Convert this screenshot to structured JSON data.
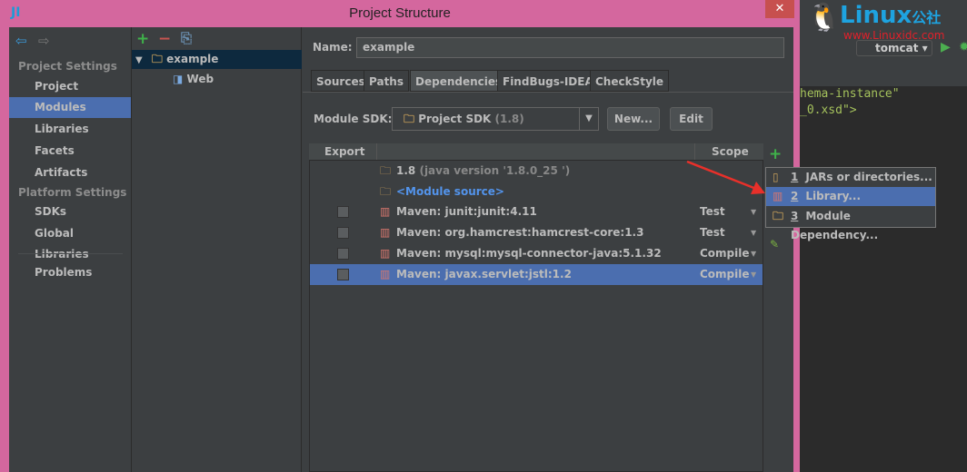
{
  "window": {
    "title": "Project Structure",
    "close": "✕",
    "logo": "JI"
  },
  "nav": {
    "back": "⇦",
    "forward": "⇨"
  },
  "sidebar": {
    "project_settings": "Project Settings",
    "items": [
      "Project",
      "Modules",
      "Libraries",
      "Facets",
      "Artifacts"
    ],
    "platform_settings": "Platform Settings",
    "platform_items": [
      "SDKs",
      "Global Libraries"
    ],
    "problems": "Problems"
  },
  "tree": {
    "add": "+",
    "remove": "−",
    "copy": "⎘",
    "module": "example",
    "facet": "Web"
  },
  "form": {
    "name_label": "Name:",
    "name_value": "example",
    "sdk_label": "Module SDK:",
    "sdk_value": "Project SDK",
    "sdk_version": "(1.8)",
    "new_btn": "New...",
    "edit_btn": "Edit"
  },
  "tabs": [
    "Sources",
    "Paths",
    "Dependencies",
    "FindBugs-IDEA",
    "CheckStyle"
  ],
  "table": {
    "headers": {
      "export": "Export",
      "scope": "Scope"
    },
    "sdk_row": {
      "name": "1.8",
      "detail": "(java version  '1.8.0_25 ')"
    },
    "source_row": "<Module source>",
    "rows": [
      {
        "name": "Maven: junit:junit:4.11",
        "scope": "Test"
      },
      {
        "name": "Maven: org.hamcrest:hamcrest-core:1.3",
        "scope": "Test"
      },
      {
        "name": "Maven: mysql:mysql-connector-java:5.1.32",
        "scope": "Compile"
      },
      {
        "name": "Maven: javax.servlet:jstl:1.2",
        "scope": "Compile"
      }
    ]
  },
  "popup": [
    {
      "num": "1",
      "label": "JARs or directories..."
    },
    {
      "num": "2",
      "label": "Library..."
    },
    {
      "num": "3",
      "label": "Module Dependency..."
    }
  ],
  "ide": {
    "run_config": "tomcat",
    "code": [
      "hema-instance\"",
      "_0.xsd\">"
    ],
    "watermark": "Linux公社 www.Linuxidc.com"
  }
}
